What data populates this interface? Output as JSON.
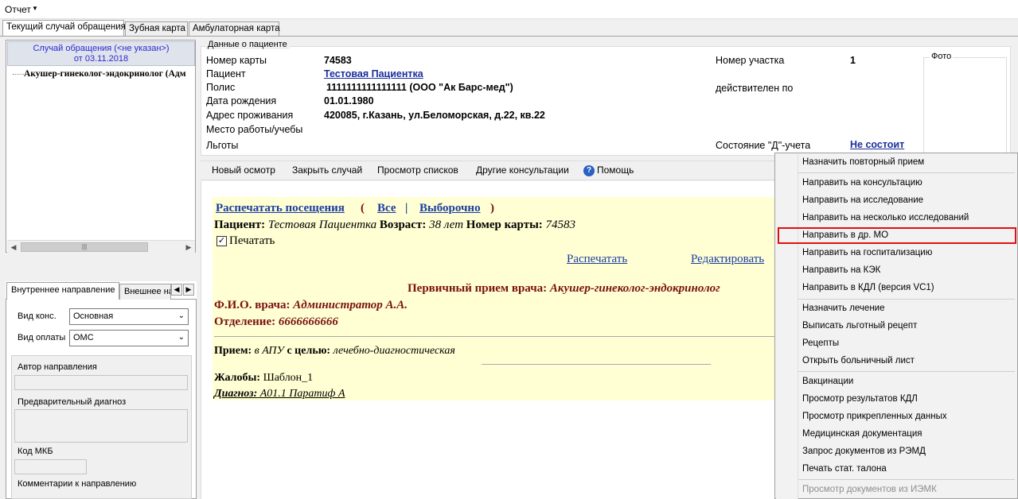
{
  "menu": {
    "report_label": "Отчет",
    "report_arrow": "▼"
  },
  "tabs": [
    "Текущий случай обращения",
    "Зубная карта",
    "Амбулаторная карта"
  ],
  "case_panel": {
    "header_line1": "Случай обращения (<не указан>)",
    "header_line2": "от 03.11.2018",
    "tree_item": "Акушер-гинеколог-эндокринолог (Адм"
  },
  "direction_panel": {
    "tabs": [
      "Внутреннее направление",
      "Внешнее на"
    ],
    "consult_type_label": "Вид конс.",
    "consult_type_value": "Основная",
    "payment_type_label": "Вид оплаты",
    "payment_type_value": "ОМС",
    "author_label": "Автор направления",
    "prelim_diag_label": "Предварительный диагноз",
    "mkb_label": "Код МКБ",
    "comments_label": "Комментарии к направлению"
  },
  "patient": {
    "group_title": "Данные о пациенте",
    "card_no_label": "Номер карты",
    "card_no": "74583",
    "patient_label": "Пациент",
    "patient_name": "Тестовая Пациентка",
    "policy_label": "Полис",
    "policy": "1111111111111111 (ООО \"Ак Барс-мед\")",
    "dob_label": "Дата рождения",
    "dob": "01.01.1980",
    "address_label": "Адрес проживания",
    "address": "420085, г.Казань, ул.Беломорская, д.22, кв.22",
    "work_label": "Место работы/учебы",
    "benefits_label": "Льготы",
    "district_label": "Номер участка",
    "district": "1",
    "valid_label": "действителен по",
    "d_status_label": "Состояние \"Д\"-учета",
    "d_status": "Не состоит",
    "photo_label": "Фото"
  },
  "toolbar": {
    "new_exam": "Новый осмотр",
    "close_case": "Закрыть случай",
    "view_lists": "Просмотр списков",
    "other_consult": "Другие консультации",
    "help": "Помощь",
    "help_icon": "?"
  },
  "document": {
    "print_visits": "Распечатать посещения",
    "paren_open": "(",
    "all": "Все",
    "pipe": "|",
    "selective": "Выборочно",
    "paren_close": ")",
    "patient_label": "Пациент:",
    "patient_name": "Тестовая Пациентка",
    "age_label": "Возраст:",
    "age": "38 лет",
    "card_label": "Номер карты:",
    "card_no": "74583",
    "print_check_label": "Печатать",
    "print_link": "Распечатать",
    "edit_link": "Редактировать",
    "visit_title_label": "Первичный прием врача:",
    "visit_title_value": "Акушер-гинеколог-эндокринолог",
    "doctor_label": "Ф.И.О. врача:",
    "doctor_name": "Администратор А.А.",
    "dept_label": "Отделение:",
    "dept_value": "6666666666",
    "reception_label": "Прием:",
    "reception_place": "в АПУ",
    "reception_purpose_label": "с целью:",
    "reception_purpose": "лечебно-диагностическая",
    "complaints_label": "Жалобы:",
    "complaints": "Шаблон_1",
    "diagnosis_label": "Диагноз:",
    "diagnosis": "А01.1 Паратиф А"
  },
  "context_menu": {
    "items": [
      "Назначить повторный прием",
      "Направить на консультацию",
      "Направить на исследование",
      "Направить на несколько исследований",
      "Направить в др. МО",
      "Направить на госпитализацию",
      "Направить на КЭК",
      "Направить в КДЛ (версия VC1)",
      "Назначить лечение",
      "Выписать льготный рецепт",
      "Рецепты",
      "Открыть больничный лист",
      "Вакцинации",
      "Просмотр результатов КДЛ",
      "Просмотр прикрепленных данных",
      "Медицинская документация",
      "Запрос документов из РЭМД",
      "Печать стат. талона",
      "Просмотр документов из ИЭМК"
    ],
    "highlight_color": "#e01010"
  }
}
